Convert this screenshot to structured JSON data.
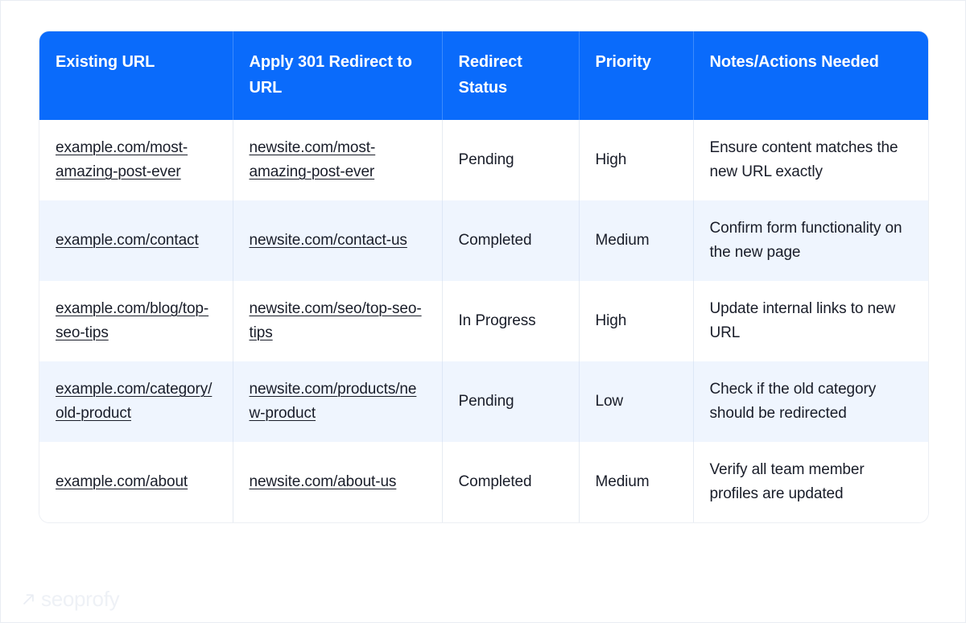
{
  "table": {
    "columns": [
      {
        "label": "Existing URL"
      },
      {
        "label": "Apply 301 Redirect to URL"
      },
      {
        "label": "Redirect Status"
      },
      {
        "label": "Priority"
      },
      {
        "label": "Notes/Actions Needed"
      }
    ],
    "rows": [
      {
        "existing_url": "example.com/most-amazing-post-ever",
        "redirect_to_url": "newsite.com/most-amazing-post-ever",
        "redirect_status": "Pending",
        "priority": "High",
        "notes": "Ensure content matches the new URL exactly"
      },
      {
        "existing_url": "example.com/contact",
        "redirect_to_url": "newsite.com/contact-us",
        "redirect_status": "Completed",
        "priority": "Medium",
        "notes": "Confirm form functionality on the new page"
      },
      {
        "existing_url": "example.com/blog/top-seo-tips",
        "redirect_to_url": "newsite.com/seo/top-seo-tips",
        "redirect_status": "In Progress",
        "priority": "High",
        "notes": "Update internal links to new URL"
      },
      {
        "existing_url": "example.com/category/old-product",
        "redirect_to_url": "newsite.com/products/new-product",
        "redirect_status": "Pending",
        "priority": "Low",
        "notes": "Check if the old category should be redirected"
      },
      {
        "existing_url": "example.com/about",
        "redirect_to_url": "newsite.com/about-us",
        "redirect_status": "Completed",
        "priority": "Medium",
        "notes": "Verify all team member profiles are updated"
      }
    ]
  },
  "watermark": {
    "brand": "seoprofy",
    "icon": "arrow-up-right-icon"
  },
  "colors": {
    "header_blue": "#0a6bfb",
    "header_text": "#ffffff",
    "row_alt_background": "#eff5fe",
    "row_background": "#ffffff",
    "body_text": "#191d29",
    "divider": "#e6ebf2",
    "watermark_text": "#eef1f6"
  }
}
